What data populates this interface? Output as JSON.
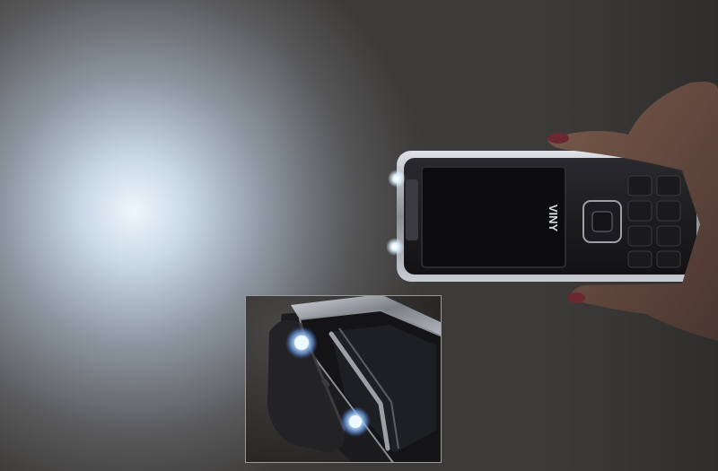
{
  "photo": {
    "subject": "phone-with-flashlight",
    "brand_label": "VINY",
    "colors": {
      "beam": "#d8e6f2",
      "wall_dark": "#3d3b39",
      "phone_body": "#1a1a1c",
      "chrome": "#b8bcc2",
      "led": "#e8f6ff",
      "skin": "#c89a86",
      "nail": "#7a2a34"
    }
  }
}
